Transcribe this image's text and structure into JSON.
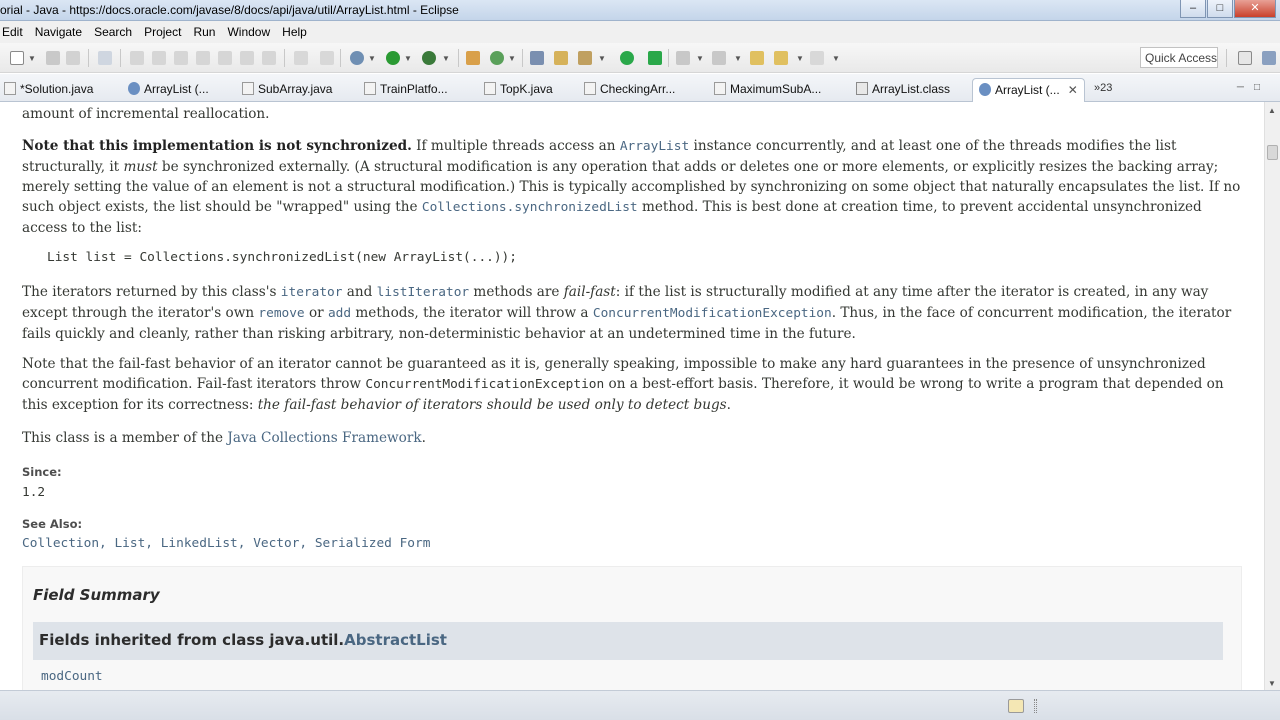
{
  "window": {
    "title": "orial - Java - https://docs.oracle.com/javase/8/docs/api/java/util/ArrayList.html - Eclipse",
    "controls": [
      "minimize",
      "maximize",
      "close"
    ]
  },
  "menu": [
    "Edit",
    "Navigate",
    "Search",
    "Project",
    "Run",
    "Window",
    "Help"
  ],
  "toolbar": {
    "quick_access": "Quick Access"
  },
  "tabs": [
    {
      "label": "*Solution.java",
      "icon": "java-file-icon"
    },
    {
      "label": "ArrayList (...",
      "icon": "browser-icon"
    },
    {
      "label": "SubArray.java",
      "icon": "java-file-icon"
    },
    {
      "label": "TrainPlatfo...",
      "icon": "java-file-icon"
    },
    {
      "label": "TopK.java",
      "icon": "java-file-icon"
    },
    {
      "label": "CheckingArr...",
      "icon": "java-file-icon"
    },
    {
      "label": "MaximumSubA...",
      "icon": "java-file-icon"
    },
    {
      "label": "ArrayList.class",
      "icon": "class-file-icon"
    },
    {
      "label": "ArrayList (...",
      "icon": "browser-icon",
      "active": true
    }
  ],
  "tab_overflow": "»23",
  "doc": {
    "line0": "amount of incremental reallocation.",
    "p1": {
      "bold": "Note that this implementation is not synchronized.",
      "t1": " If multiple threads access an ",
      "c1": "ArrayList",
      "t2": " instance concurrently, and at least one of the threads modifies the list structurally, it ",
      "em": "must",
      "t3": " be synchronized externally. (A structural modification is any operation that adds or deletes one or more elements, or explicitly resizes the backing array; merely setting the value of an element is not a structural modification.) This is typically accomplished by synchronizing on some object that naturally encapsulates the list. If no such object exists, the list should be \"wrapped\" using the ",
      "c2": "Collections.synchronizedList",
      "t4": " method. This is best done at creation time, to prevent accidental unsynchronized access to the list:"
    },
    "code": "List list = Collections.synchronizedList(new ArrayList(...));",
    "p2": {
      "t1": "The iterators returned by this class's ",
      "c1": "iterator",
      "t2": " and ",
      "c2": "listIterator",
      "t3": " methods are ",
      "em": "fail-fast",
      "t4": ": if the list is structurally modified at any time after the iterator is created, in any way except through the iterator's own ",
      "c3": "remove",
      "t5": " or ",
      "c4": "add",
      "t6": " methods, the iterator will throw a ",
      "c5": "ConcurrentModificationException",
      "t7": ". Thus, in the face of concurrent modification, the iterator fails quickly and cleanly, rather than risking arbitrary, non-deterministic behavior at an undetermined time in the future."
    },
    "p3": {
      "t1": "Note that the fail-fast behavior of an iterator cannot be guaranteed as it is, generally speaking, impossible to make any hard guarantees in the presence of unsynchronized concurrent modification. Fail-fast iterators throw ",
      "c1": "ConcurrentModificationException",
      "t2": " on a best-effort basis. Therefore, it would be wrong to write a program that depended on this exception for its correctness: ",
      "em": "the fail-fast behavior of iterators should be used only to detect bugs",
      "t3": "."
    },
    "p4": {
      "t1": "This class is a member of the ",
      "link": "Java Collections Framework",
      "t2": "."
    },
    "since_label": "Since:",
    "since_value": "1.2",
    "see_also_label": "See Also:",
    "see_also": [
      "Collection",
      "List",
      "LinkedList",
      "Vector",
      "Serialized Form"
    ],
    "field_summary_title": "Field Summary",
    "fields_inherited_prefix": "Fields inherited from class java.util.",
    "fields_inherited_link": "AbstractList",
    "fields_inherited_value": "modCount"
  }
}
